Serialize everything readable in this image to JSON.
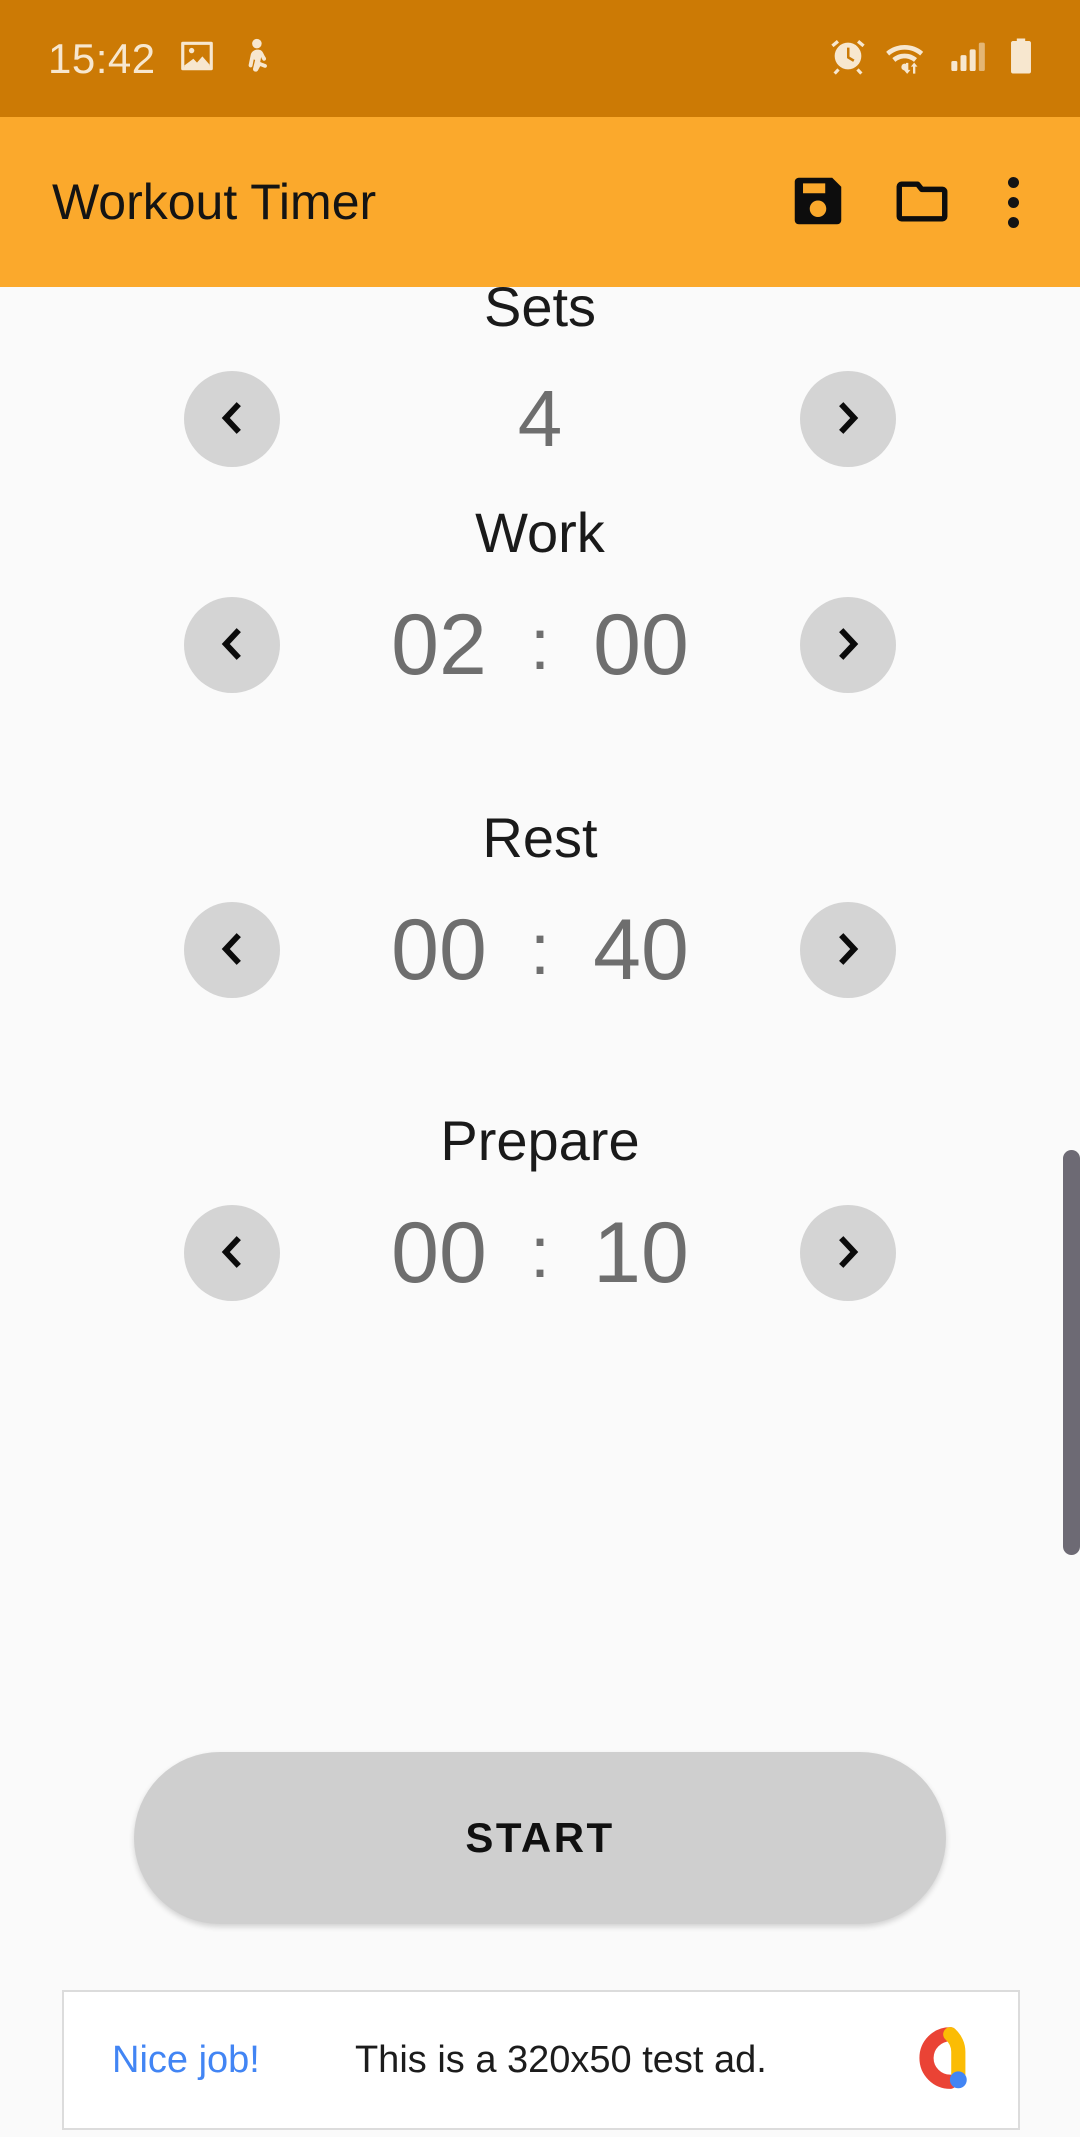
{
  "status_bar": {
    "time": "15:42",
    "left_icons": [
      "image-icon",
      "person-icon"
    ],
    "right_icons": [
      "alarm-icon",
      "wifi-icon",
      "signal-icon",
      "battery-icon"
    ],
    "background_color": "#CC7A05",
    "text_color": "#F7E7CF"
  },
  "app_bar": {
    "title": "Workout Timer",
    "background_color": "#FBA92C",
    "actions": [
      {
        "name": "save-icon",
        "label": "Save"
      },
      {
        "name": "folder-icon",
        "label": "Open"
      },
      {
        "name": "overflow-menu-icon",
        "label": "More options"
      }
    ]
  },
  "fields": [
    {
      "id": "sets",
      "label": "Sets",
      "type": "count",
      "value": "4",
      "decrement_label": "‹",
      "increment_label": "›"
    },
    {
      "id": "work",
      "label": "Work",
      "type": "time",
      "minutes": "02",
      "seconds": "00",
      "separator": ":",
      "decrement_label": "‹",
      "increment_label": "›"
    },
    {
      "id": "rest",
      "label": "Rest",
      "type": "time",
      "minutes": "00",
      "seconds": "40",
      "separator": ":",
      "decrement_label": "‹",
      "increment_label": "›"
    },
    {
      "id": "prepare",
      "label": "Prepare",
      "type": "time",
      "minutes": "00",
      "seconds": "10",
      "separator": ":",
      "decrement_label": "‹",
      "increment_label": "›"
    }
  ],
  "start_button": {
    "label": "START",
    "background_color": "#CFCFCF"
  },
  "ad": {
    "cta": "Nice job!",
    "text": "This is a 320x50 test ad.",
    "logo": "admob-logo-icon",
    "cta_color": "#4285F4"
  },
  "scrollbar": {
    "visible": true,
    "color": "#6D6A74"
  },
  "theme": {
    "background": "#FAFAFA",
    "accent": "#FBA92C",
    "accent_dark": "#CC7A05",
    "value_text": "#6E6E6E",
    "label_text": "#1A1A1A",
    "button_gray": "#D4D4D4"
  }
}
